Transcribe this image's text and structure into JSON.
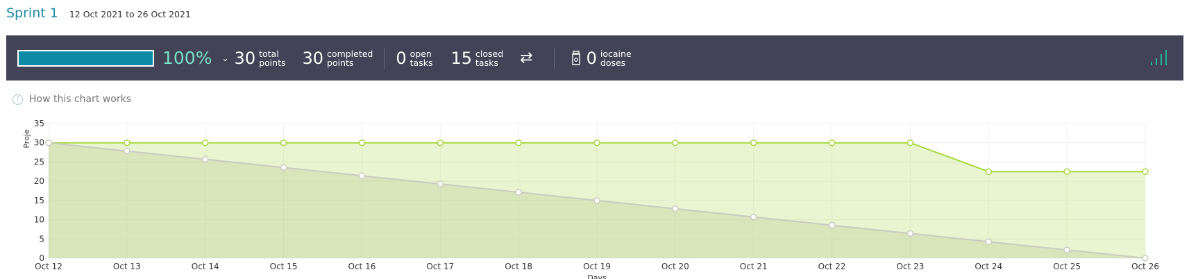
{
  "sprint": {
    "title": "Sprint 1",
    "dates": "12 Oct 2021 to 26 Oct 2021"
  },
  "summary": {
    "progress_fraction": 1.0,
    "percent": "100%",
    "total_points": {
      "value": "30",
      "label1": "total",
      "label2": "points"
    },
    "completed_points": {
      "value": "30",
      "label1": "completed",
      "label2": "points"
    },
    "open_tasks": {
      "value": "0",
      "label1": "open",
      "label2": "tasks"
    },
    "closed_tasks": {
      "value": "15",
      "label1": "closed",
      "label2": "tasks"
    },
    "iocaine": {
      "value": "0",
      "label1": "iocaine",
      "label2": "doses"
    },
    "icons": [
      "chevron-down-icon",
      "swap-arrows-icon",
      "jar-icon",
      "signal-icon"
    ],
    "colors": {
      "bar_bg": "#424356",
      "progress": "#0c8aa6",
      "percent": "#78e0c8"
    }
  },
  "help": {
    "text": "How this chart works"
  },
  "chart_data": {
    "type": "area",
    "x": [
      "Oct 12",
      "Oct 13",
      "Oct 14",
      "Oct 15",
      "Oct 16",
      "Oct 17",
      "Oct 18",
      "Oct 19",
      "Oct 20",
      "Oct 21",
      "Oct 22",
      "Oct 23",
      "Oct 24",
      "Oct 25",
      "Oct 26"
    ],
    "series": [
      {
        "values": [
          30,
          30,
          30,
          30,
          30,
          30,
          30,
          30,
          30,
          30,
          30,
          30,
          22.5,
          22.5,
          22.5
        ],
        "color": "#a6d83c"
      },
      {
        "values": [
          30,
          27.86,
          25.71,
          23.57,
          21.43,
          19.29,
          17.14,
          15,
          12.86,
          10.71,
          8.57,
          6.43,
          4.29,
          2.14,
          0
        ],
        "color": "#c9ccc2"
      }
    ],
    "ylabel": "Proje",
    "xlabel": "Days",
    "ylim": [
      0,
      35
    ],
    "yticks": [
      0,
      5,
      10,
      15,
      20,
      25,
      30,
      35
    ],
    "grid": true
  }
}
